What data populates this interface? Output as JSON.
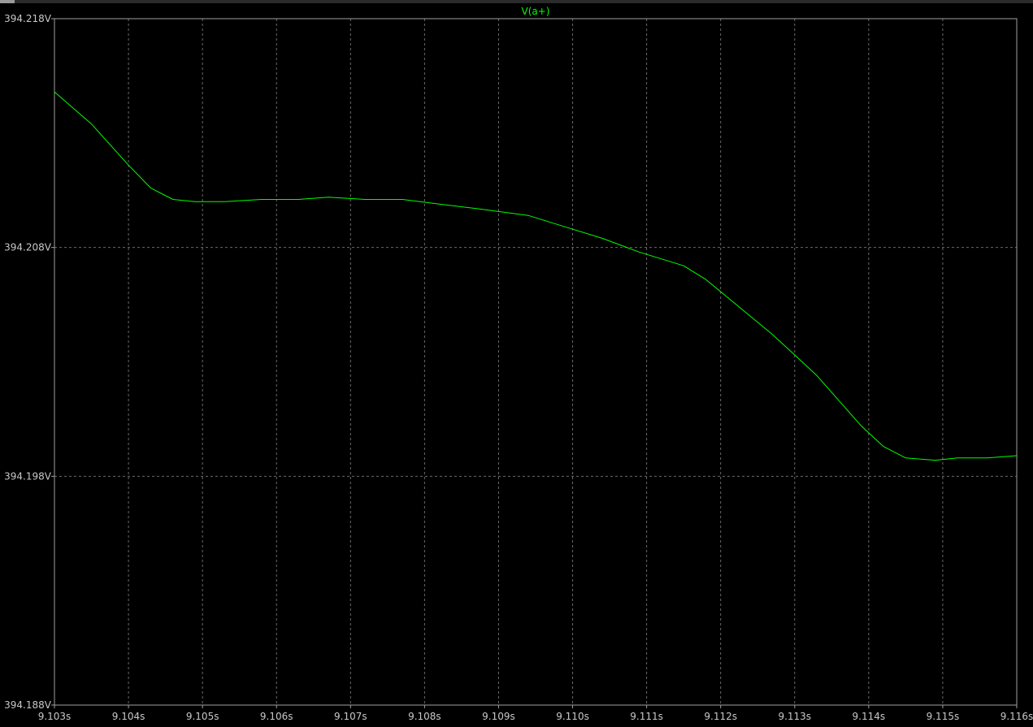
{
  "colors": {
    "background": "#000000",
    "frame": "#a0a0a0",
    "grid": "#6a6a6a",
    "text": "#c8c8c8",
    "trace": "#00ff00"
  },
  "chart_data": {
    "type": "line",
    "title": "V(a+)",
    "xlabel": "",
    "ylabel": "",
    "xlim": [
      9.103,
      9.116
    ],
    "ylim": [
      394.188,
      394.218
    ],
    "grid": true,
    "x_ticks": [
      9.103,
      9.104,
      9.105,
      9.106,
      9.107,
      9.108,
      9.109,
      9.11,
      9.111,
      9.112,
      9.113,
      9.114,
      9.115,
      9.116
    ],
    "x_tick_labels": [
      "9.103s",
      "9.104s",
      "9.105s",
      "9.106s",
      "9.107s",
      "9.108s",
      "9.109s",
      "9.110s",
      "9.111s",
      "9.112s",
      "9.113s",
      "9.114s",
      "9.115s",
      "9.116s"
    ],
    "y_ticks": [
      394.188,
      394.198,
      394.208,
      394.218
    ],
    "y_tick_labels": [
      "394.188V",
      "394.198V",
      "394.208V",
      "394.218V"
    ],
    "series": [
      {
        "name": "V(a+)",
        "color": "#00ff00",
        "x": [
          9.103,
          9.1035,
          9.104,
          9.1043,
          9.1046,
          9.1049,
          9.1053,
          9.1058,
          9.1063,
          9.1067,
          9.1072,
          9.1077,
          9.1082,
          9.1087,
          9.1094,
          9.1099,
          9.1104,
          9.1109,
          9.1115,
          9.1118,
          9.1121,
          9.1124,
          9.1127,
          9.113,
          9.1133,
          9.1136,
          9.1139,
          9.1142,
          9.1145,
          9.1149,
          9.1152,
          9.1156,
          9.116
        ],
        "y": [
          394.2148,
          394.2134,
          394.2116,
          394.2106,
          394.2101,
          394.21,
          394.21,
          394.2101,
          394.2101,
          394.2102,
          394.2101,
          394.2101,
          394.2099,
          394.2097,
          394.2094,
          394.2089,
          394.2084,
          394.2078,
          394.2072,
          394.2066,
          394.2058,
          394.205,
          394.2042,
          394.2033,
          394.2024,
          394.2013,
          394.2002,
          394.1993,
          394.1988,
          394.1987,
          394.1988,
          394.1988,
          394.1989
        ]
      }
    ]
  }
}
